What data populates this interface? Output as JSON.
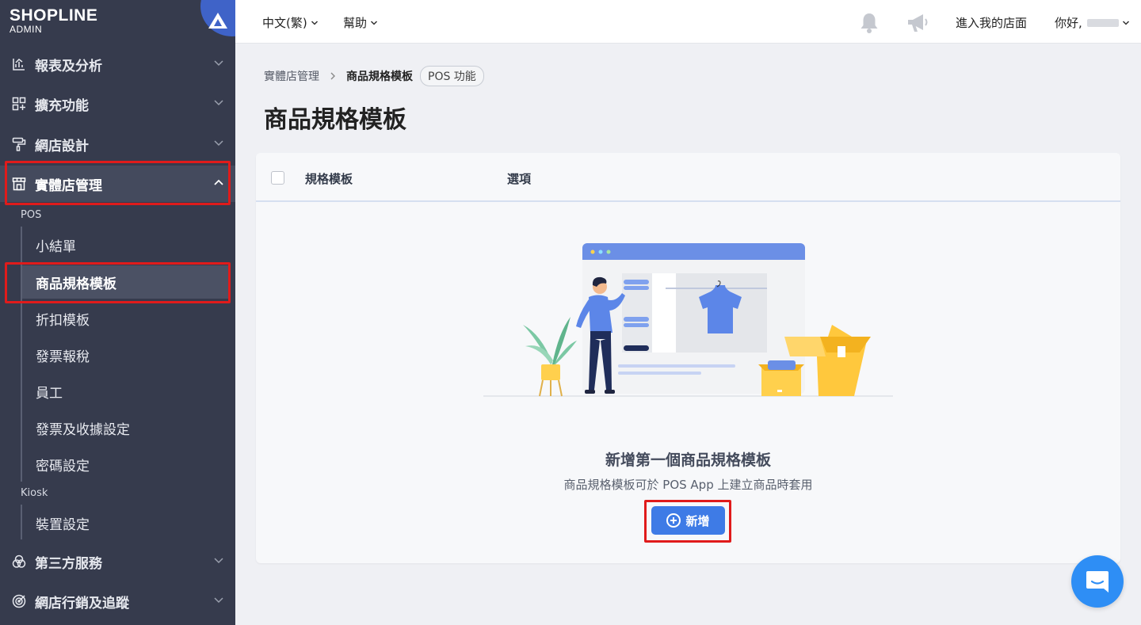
{
  "brand": {
    "name": "SHOPLINE",
    "sub": "ADMIN"
  },
  "sidebar": {
    "items": [
      {
        "label": "報表及分析",
        "icon": "chart-icon"
      },
      {
        "label": "擴充功能",
        "icon": "apps-icon"
      },
      {
        "label": "網店設計",
        "icon": "paint-roller-icon"
      },
      {
        "label": "實體店管理",
        "icon": "store-icon"
      },
      {
        "label": "第三方服務",
        "icon": "circles-icon"
      },
      {
        "label": "網店行銷及追蹤",
        "icon": "target-icon"
      }
    ],
    "groups": {
      "pos": {
        "label": "POS",
        "items": [
          "小結單",
          "商品規格模板",
          "折扣模板",
          "發票報稅",
          "員工",
          "發票及收據設定",
          "密碼設定"
        ]
      },
      "kiosk": {
        "label": "Kiosk",
        "items": [
          "裝置設定"
        ]
      }
    }
  },
  "topbar": {
    "language": "中文(繁)",
    "help": "幫助",
    "store_link": "進入我的店面",
    "greeting": "你好,"
  },
  "breadcrumb": {
    "parent": "實體店管理",
    "current": "商品規格模板",
    "badge": "POS 功能"
  },
  "page": {
    "title": "商品規格模板"
  },
  "table": {
    "columns": [
      "規格模板",
      "選項"
    ]
  },
  "empty": {
    "title": "新增第一個商品規格模板",
    "desc": "商品規格模板可於 POS App 上建立商品時套用",
    "button": "新增"
  }
}
